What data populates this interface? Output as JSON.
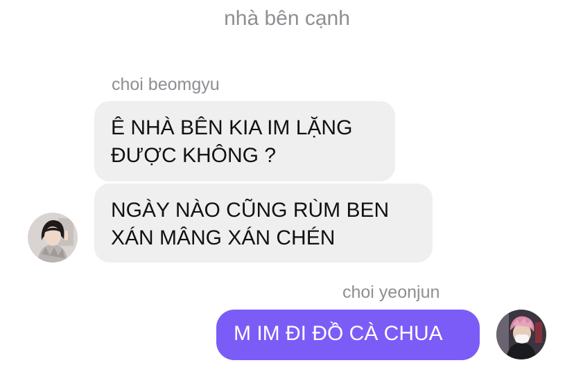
{
  "chat": {
    "title": "nhà bên cạnh"
  },
  "messages": {
    "incoming": {
      "sender": "choi beomgyu",
      "bubbles": [
        "Ê NHÀ BÊN KIA IM LẶNG\nĐƯỢC KHÔNG ?",
        "NGÀY NÀO CŨNG RÙM BEN\nXÁN MÂNG XÁN CHÉN"
      ]
    },
    "outgoing": {
      "sender": "choi yeonjun",
      "bubbles": [
        "M IM ĐI ĐỒ CÀ CHUA"
      ]
    }
  },
  "colors": {
    "incoming_bubble": "#efefef",
    "outgoing_bubble": "#7b5cf6",
    "secondary_text": "#8e8e93"
  },
  "icons": {
    "incoming_avatar": "avatar-photo",
    "outgoing_avatar": "avatar-photo"
  }
}
